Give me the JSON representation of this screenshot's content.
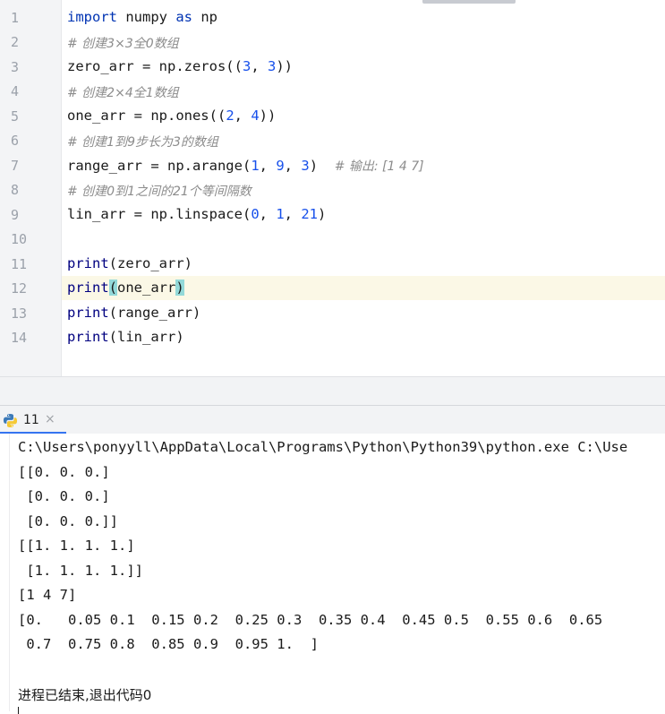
{
  "editor": {
    "line_numbers": [
      "1",
      "2",
      "3",
      "4",
      "5",
      "6",
      "7",
      "8",
      "9",
      "10",
      "11",
      "12",
      "13",
      "14"
    ],
    "lines": {
      "l1": {
        "kw_import": "import",
        "mid": " numpy ",
        "kw_as": "as",
        "tail": " np"
      },
      "l2": {
        "comment": "# 创建3×3全0数组"
      },
      "l3": {
        "a": "zero_arr = np.zeros((",
        "n1": "3",
        ", ": ", ",
        "n2": "3",
        "end": "))"
      },
      "l4": {
        "comment": "# 创建2×4全1数组"
      },
      "l5": {
        "a": "one_arr = np.ones((",
        "n1": "2",
        "sep": ", ",
        "n2": "4",
        "end": "))"
      },
      "l6": {
        "comment": "# 创建1到9步长为3的数组"
      },
      "l7": {
        "a": "range_arr = np.arange(",
        "n1": "1",
        "s1": ", ",
        "n2": "9",
        "s2": ", ",
        "n3": "3",
        "end": ")  ",
        "comment": "# 输出: [1 4 7]"
      },
      "l8": {
        "comment": "# 创建0到1之间的21个等间隔数"
      },
      "l9": {
        "a": "lin_arr = np.linspace(",
        "n1": "0",
        "s1": ", ",
        "n2": "1",
        "s2": ", ",
        "n3": "21",
        "end": ")"
      },
      "l11": {
        "fn": "print",
        "arg": "(zero_arr)"
      },
      "l12": {
        "fn": "print",
        "open": "(",
        "arg": "one_arr",
        "close": ")"
      },
      "l13": {
        "fn": "print",
        "arg": "(range_arr)"
      },
      "l14": {
        "fn": "print",
        "arg": "(lin_arr)"
      }
    }
  },
  "run_panel": {
    "tab_label": "11",
    "close_glyph": "×",
    "icon": "python-icon"
  },
  "console": {
    "lines": [
      "C:\\Users\\ponyyll\\AppData\\Local\\Programs\\Python\\Python39\\python.exe C:\\Use",
      "[[0. 0. 0.]",
      " [0. 0. 0.]",
      " [0. 0. 0.]]",
      "[[1. 1. 1. 1.]",
      " [1. 1. 1. 1.]]",
      "[1 4 7]",
      "[0.   0.05 0.1  0.15 0.2  0.25 0.3  0.35 0.4  0.45 0.5  0.55 0.6  0.65",
      " 0.7  0.75 0.8  0.85 0.9  0.95 1.  ]"
    ],
    "exit_message": "进程已结束,退出代码0"
  },
  "colors": {
    "keyword": "#0033b3",
    "number": "#1750eb",
    "comment": "#8c8c8c",
    "current_line": "#fbf8e6",
    "brace_match": "#93d9d9",
    "tab_accent": "#3574f0"
  }
}
